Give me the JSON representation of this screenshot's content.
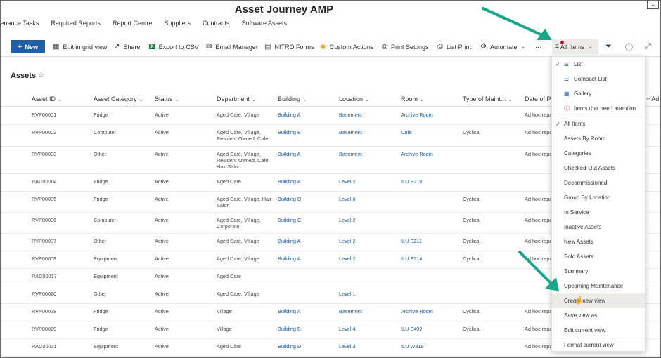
{
  "site": {
    "title": "Asset Journey AMP"
  },
  "nav": {
    "items": [
      "ntenance Tasks",
      "Required Reports",
      "Report Centre",
      "Suppliers",
      "Contracts",
      "Software Assets"
    ]
  },
  "commands": {
    "new": "New",
    "edit_grid": "Edit in grid view",
    "share": "Share",
    "export_csv": "Export to CSV",
    "email_manager": "Email Manager",
    "nitro_forms": "NITRO Forms",
    "custom_actions": "Custom Actions",
    "print_settings": "Print Settings",
    "list_print": "List Print",
    "automate": "Automate",
    "more": "···",
    "view_selector": "All Items"
  },
  "page": {
    "title": "Assets"
  },
  "columns": [
    "Asset ID",
    "Asset Category",
    "Status",
    "Department",
    "Building",
    "Location",
    "Room",
    "Type of Maint...",
    "Date of Pr",
    "+ Ad"
  ],
  "rows": [
    {
      "id": "RVP00001",
      "category": "Fridge",
      "status": "Active",
      "department": "Aged Care, Village",
      "building": "Building A",
      "location": "Basement",
      "room": "Archive Room",
      "type": "",
      "date": "Ad hoc repa"
    },
    {
      "id": "RVP00002",
      "category": "Computer",
      "status": "Active",
      "department": "Aged Care, Village, Resident Owned, Cafe",
      "building": "Building B",
      "location": "Basement",
      "room": "Cafe",
      "type": "Cyclical",
      "date": "Ad hoc repa"
    },
    {
      "id": "RVP00003",
      "category": "Other",
      "status": "Active",
      "department": "Aged Care, Village, Resident Owned, Cafe, Hair Salon",
      "building": "Building A",
      "location": "Basement",
      "room": "Archive Room",
      "type": "",
      "date": "Ad hoc repa"
    },
    {
      "id": "RAC00004",
      "category": "Fridge",
      "status": "Active",
      "department": "Aged Care",
      "building": "Building A",
      "location": "Level 2",
      "room": "ILU E210",
      "type": "",
      "date": ""
    },
    {
      "id": "RVP00005",
      "category": "Fridge",
      "status": "Active",
      "department": "Aged Care, Village, Hair Salon",
      "building": "Building D",
      "location": "Level 6",
      "room": "",
      "type": "Cyclical",
      "date": "Ad hoc repa"
    },
    {
      "id": "RVP00006",
      "category": "Computer",
      "status": "Active",
      "department": "Aged Care, Village, Corporate",
      "building": "Building C",
      "location": "Level 2",
      "room": "",
      "type": "Cyclical",
      "date": "Ad hoc repa"
    },
    {
      "id": "RVP00007",
      "category": "Other",
      "status": "Active",
      "department": "Aged Care, Village",
      "building": "Building A",
      "location": "Level 2",
      "room": "ILU E211",
      "type": "Cyclical",
      "date": "Ad hoc repa"
    },
    {
      "id": "RVP00008",
      "category": "Equipment",
      "status": "Active",
      "department": "Aged Care, Village",
      "building": "Building A",
      "location": "Level 2",
      "room": "ILU E214",
      "type": "Cyclical",
      "date": "Ad hoc repa"
    },
    {
      "id": "RAC00017",
      "category": "Equipment",
      "status": "Active",
      "department": "Aged Care",
      "building": "",
      "location": "",
      "room": "",
      "type": "",
      "date": ""
    },
    {
      "id": "RVP00020",
      "category": "Other",
      "status": "Active",
      "department": "Aged Care, Village",
      "building": "",
      "location": "Level 1",
      "room": "",
      "type": "",
      "date": ""
    },
    {
      "id": "RVP00028",
      "category": "Fridge",
      "status": "Active",
      "department": "Village",
      "building": "Building A",
      "location": "Basement",
      "room": "Archive Room",
      "type": "Cyclical",
      "date": "Ad hoc repa"
    },
    {
      "id": "RVP00029",
      "category": "Fridge",
      "status": "Active",
      "department": "Village",
      "building": "Building B",
      "location": "Level 4",
      "room": "ILU E402",
      "type": "Cyclical",
      "date": "Ad hoc repa"
    },
    {
      "id": "RAC00031",
      "category": "Equipment",
      "status": "Active",
      "department": "Aged Care",
      "building": "Building D",
      "location": "Level 3",
      "room": "ILU W319",
      "type": "",
      "date": "Ad hoc repa"
    }
  ],
  "view_menu": {
    "layouts": [
      "List",
      "Compact List",
      "Gallery",
      "Items that need attention"
    ],
    "views": [
      "All Items",
      "Assets By Room",
      "Categories",
      "Checked-Out Assets",
      "Decommissioned",
      "Group By Location",
      "In Service",
      "Inactive Assets",
      "New Assets",
      "Sold Assets",
      "Summary",
      "Upcoming Maintenance"
    ],
    "actions": [
      "Create new view",
      "Save view as",
      "Edit current view",
      "Format current view"
    ]
  },
  "colors": {
    "accent": "#1f5fa6",
    "link": "#1d5a9a",
    "arrow": "#1aa68a",
    "alert": "#c50f1f"
  },
  "icons": {
    "list": "list-icon",
    "compact": "compact-list-icon",
    "gallery": "gallery-icon",
    "attention": "alert-icon",
    "check": "checkmark-icon"
  }
}
